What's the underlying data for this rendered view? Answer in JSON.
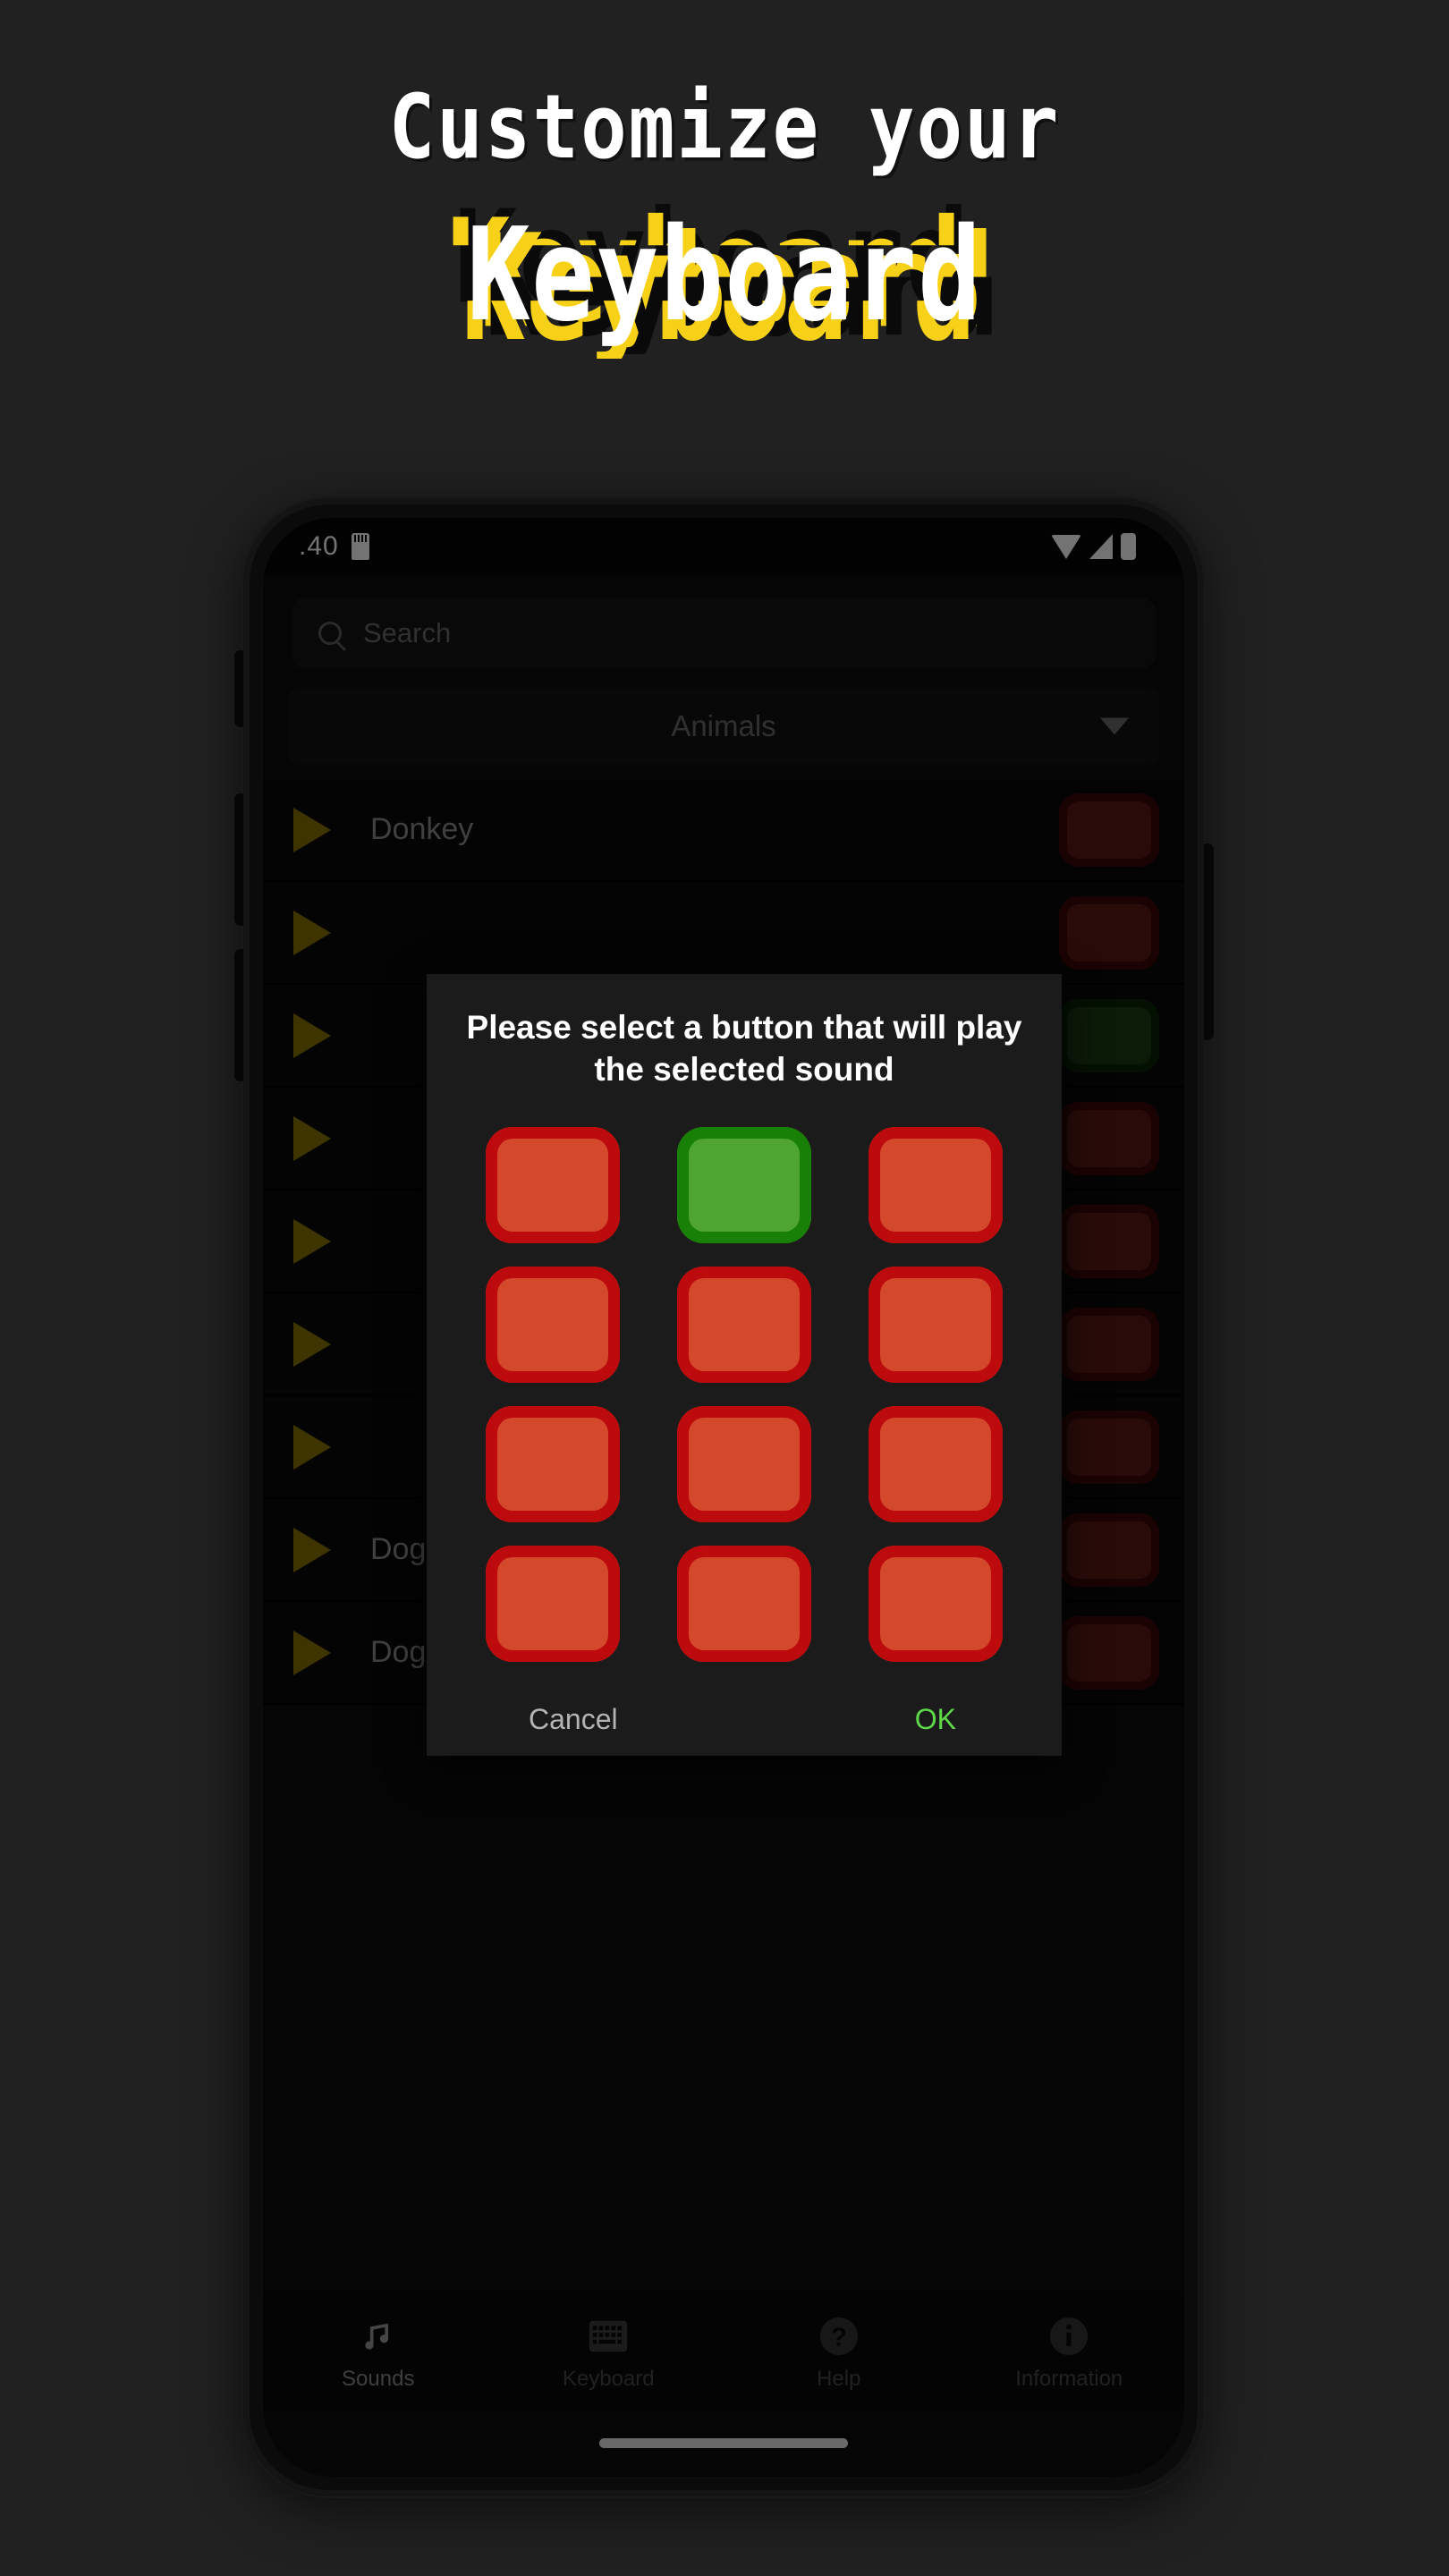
{
  "hero": {
    "line1": "Customize your",
    "line2": "Keyboard",
    "accent_yellow": "#f7d117",
    "accent_white": "#ffffff"
  },
  "phone": {
    "statusbar": {
      "time": ".40",
      "sd_icon": "sd-card-icon",
      "wifi_icon": "wifi-icon",
      "signal_icon": "cell-signal-icon",
      "battery_icon": "battery-icon"
    },
    "search": {
      "icon": "search-icon",
      "placeholder": "Search",
      "value": ""
    },
    "category_dropdown": {
      "selected": "Animals",
      "caret_icon": "chevron-down-icon"
    },
    "list": {
      "rows": [
        {
          "label": "Donkey",
          "play_icon": "play-icon",
          "button_color": "red"
        },
        {
          "label": "",
          "play_icon": "play-icon",
          "button_color": "red"
        },
        {
          "label": "",
          "play_icon": "play-icon",
          "button_color": "green"
        },
        {
          "label": "",
          "play_icon": "play-icon",
          "button_color": "red"
        },
        {
          "label": "",
          "play_icon": "play-icon",
          "button_color": "red"
        },
        {
          "label": "",
          "play_icon": "play-icon",
          "button_color": "red"
        },
        {
          "label": "",
          "play_icon": "play-icon",
          "button_color": "red"
        },
        {
          "label": "Dog",
          "play_icon": "play-icon",
          "button_color": "red"
        },
        {
          "label": "Dog (angry)",
          "play_icon": "play-icon",
          "button_color": "red"
        }
      ]
    },
    "bottom_nav": {
      "items": [
        {
          "label": "Sounds",
          "icon": "music-note-icon",
          "active": true
        },
        {
          "label": "Keyboard",
          "icon": "keyboard-icon",
          "active": false
        },
        {
          "label": "Help",
          "icon": "question-mark-circle-icon",
          "active": false
        },
        {
          "label": "Information",
          "icon": "info-circle-icon",
          "active": false
        }
      ]
    }
  },
  "dialog": {
    "title": "Please select a button that will play the selected sound",
    "pads": [
      "red",
      "green",
      "red",
      "red",
      "red",
      "red",
      "red",
      "red",
      "red",
      "red",
      "red",
      "red"
    ],
    "colors": {
      "pad_red_outer": "#d4482c",
      "pad_red_inner": "#bd0a0c",
      "pad_green_outer": "#4fa531",
      "pad_green_inner": "#198006",
      "ok_green": "#5fd94a",
      "cancel_grey": "#b4b4b4"
    },
    "cancel_label": "Cancel",
    "ok_label": "OK"
  }
}
